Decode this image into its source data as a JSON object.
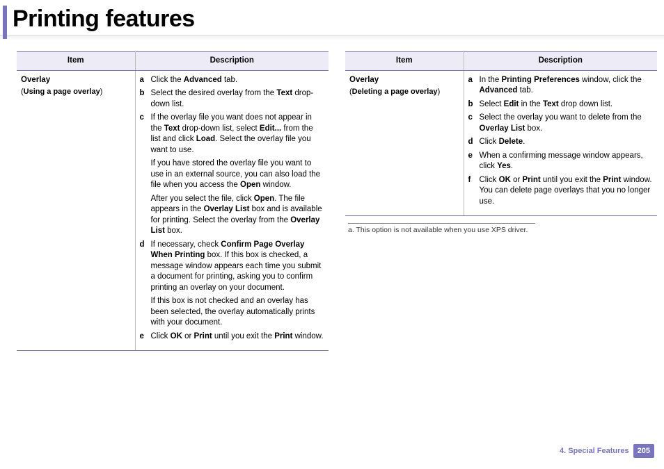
{
  "page": {
    "title": "Printing features",
    "section_label": "4.  Special Features",
    "page_number": "205"
  },
  "table_headers": {
    "item": "Item",
    "desc": "Description"
  },
  "left": {
    "item_title": "Overlay",
    "item_sub_prefix": "(",
    "item_sub_bold": "Using a page overlay",
    "item_sub_suffix": ")",
    "steps": {
      "a": {
        "letter": "a",
        "html": "Click the <b>Advanced</b> tab."
      },
      "b": {
        "letter": "b",
        "html": "Select the desired overlay from the <b>Text</b> drop-down list."
      },
      "c": {
        "letter": "c",
        "html": "If the overlay file you want does not appear in the <b>Text</b> drop-down list, select <b>Edit...</b> from the list and click <b>Load</b>. Select the overlay file you want to use.",
        "para1": "If you have stored the overlay file you want to use in an external source, you can also load the file when you access the <b>Open</b> window.",
        "para2": "After you select the file, click <b>Open</b>. The file appears in the <b>Overlay List</b> box and is available for printing. Select the overlay from the <b>Overlay List</b> box."
      },
      "d": {
        "letter": "d",
        "html": "If necessary, check <b>Confirm Page Overlay When Printing</b> box. If this box is checked, a message window appears each time you submit a document for printing, asking you to confirm printing an overlay on your document.",
        "para1": "If this box is not checked and an overlay has been selected, the overlay automatically prints with your document."
      },
      "e": {
        "letter": "e",
        "html": "Click <b>OK</b> or <b>Print</b> until you exit the <b>Print</b> window."
      }
    }
  },
  "right": {
    "item_title": "Overlay",
    "item_sub_prefix": "(",
    "item_sub_bold": "Deleting a page overlay",
    "item_sub_suffix": ")",
    "steps": {
      "a": {
        "letter": "a",
        "html": "In the <b>Printing Preferences</b> window, click the <b>Advanced</b> tab."
      },
      "b": {
        "letter": "b",
        "html": "Select <b>Edit</b> in the <b>Text</b> drop down list."
      },
      "c": {
        "letter": "c",
        "html": "Select the overlay you want to delete from the <b>Overlay List</b> box."
      },
      "d": {
        "letter": "d",
        "html": "Click <b>Delete</b>."
      },
      "e": {
        "letter": "e",
        "html": "When a confirming message window appears, click <b>Yes</b>."
      },
      "f": {
        "letter": "f",
        "html": "Click <b>OK</b> or <b>Print</b> until you exit the <b>Print</b> window. You can delete page overlays that you no longer use."
      }
    },
    "footnote": "a.  This option is not available when you use XPS driver."
  }
}
